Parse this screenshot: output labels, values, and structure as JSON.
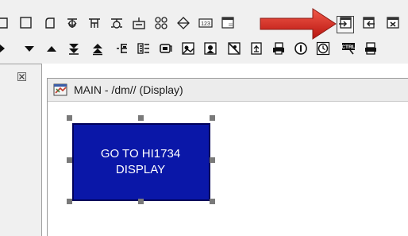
{
  "toolbar": {
    "row1": [
      {
        "icon": "open-shape-icon",
        "label": ""
      },
      {
        "icon": "square-icon",
        "label": ""
      },
      {
        "icon": "rounded-square-icon",
        "label": ""
      },
      {
        "icon": "polygon-icon",
        "label": ""
      },
      {
        "icon": "freeform-icon",
        "label": ""
      },
      {
        "icon": "valve-icon",
        "label": ""
      },
      {
        "icon": "tank-icon",
        "label": ""
      },
      {
        "icon": "grid-icon",
        "label": ""
      },
      {
        "icon": "diamond-icon",
        "label": ""
      },
      {
        "icon": "numeric-field-icon",
        "label": "123"
      },
      {
        "icon": "window-icon",
        "label": ""
      },
      {
        "icon": "display-link-icon",
        "label": ""
      },
      {
        "icon": "display-back-icon",
        "label": ""
      },
      {
        "icon": "close-display-icon",
        "label": ""
      }
    ],
    "row2": [
      {
        "icon": "play-right-icon",
        "label": ""
      },
      {
        "icon": "triangle-down-icon",
        "label": ""
      },
      {
        "icon": "triangle-up-icon",
        "label": ""
      },
      {
        "icon": "double-down-icon",
        "label": ""
      },
      {
        "icon": "double-up-icon",
        "label": ""
      },
      {
        "icon": "list-icon",
        "label": ""
      },
      {
        "icon": "detail-list-icon",
        "label": ""
      },
      {
        "icon": "screen-icon",
        "label": ""
      },
      {
        "icon": "image-icon",
        "label": ""
      },
      {
        "icon": "image-edit-icon",
        "label": ""
      },
      {
        "icon": "image-clear-icon",
        "label": ""
      },
      {
        "icon": "tree-icon",
        "label": ""
      },
      {
        "icon": "printer-icon",
        "label": ""
      },
      {
        "icon": "info-icon",
        "label": ""
      },
      {
        "icon": "clock-icon",
        "label": ""
      },
      {
        "icon": "ctrl-key-icon",
        "label": "CTRL"
      },
      {
        "icon": "stamp-icon",
        "label": ""
      }
    ]
  },
  "annotation": {
    "arrow_color": "#e0261f"
  },
  "document": {
    "title": "MAIN - /dm// (Display)"
  },
  "design_object": {
    "label": "GO TO HI1734\nDISPLAY",
    "fill_color": "#0a17a8"
  }
}
